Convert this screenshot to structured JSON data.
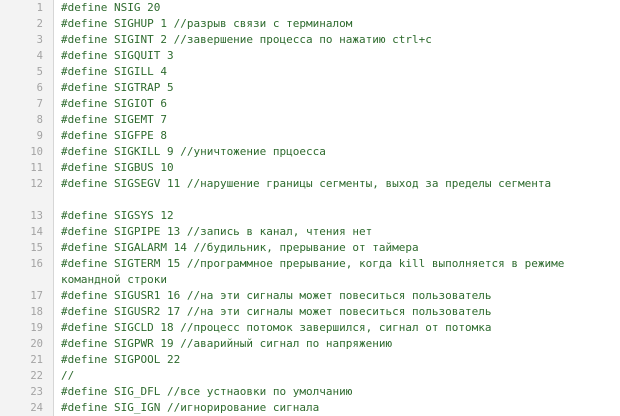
{
  "lines": [
    {
      "n": "1",
      "text": "#define NSIG 20"
    },
    {
      "n": "2",
      "text": "#define SIGHUP 1 //разрыв связи с терминалом"
    },
    {
      "n": "3",
      "text": "#define SIGINT 2 //завершение процесса по нажатию ctrl+c"
    },
    {
      "n": "4",
      "text": "#define SIGQUIT 3"
    },
    {
      "n": "5",
      "text": "#define SIGILL 4"
    },
    {
      "n": "6",
      "text": "#define SIGTRAP 5"
    },
    {
      "n": "7",
      "text": "#define SIGIOT 6"
    },
    {
      "n": "8",
      "text": "#define SIGEMT 7"
    },
    {
      "n": "9",
      "text": "#define SIGFPE 8"
    },
    {
      "n": "10",
      "text": "#define SIGKILL 9 //уничтожение прцоесса"
    },
    {
      "n": "11",
      "text": "#define SIGBUS 10"
    },
    {
      "n": "12",
      "text": "#define SIGSEGV 11 //нарушение границы сегменты, выход за пределы сегмента"
    },
    {
      "n": "13",
      "text": "#define SIGSYS 12"
    },
    {
      "n": "14",
      "text": "#define SIGPIPE 13 //запись в канал, чтения нет"
    },
    {
      "n": "15",
      "text": "#define SIGALARM 14 //будильник, прерывание от таймера"
    },
    {
      "n": "16",
      "text": "#define SIGTERM 15 //программное прерывание, когда kill выполняется в режиме командной строки"
    },
    {
      "n": "17",
      "text": "#define SIGUSR1 16 //на эти сигналы может повеситься пользователь"
    },
    {
      "n": "18",
      "text": "#define SIGUSR2 17 //на эти сигналы может повеситься пользователь"
    },
    {
      "n": "19",
      "text": "#define SIGCLD 18 //процесс потомок завершился, сигнал от потомка"
    },
    {
      "n": "20",
      "text": "#define SIGPWR 19 //аварийный сигнал по напряжению"
    },
    {
      "n": "21",
      "text": "#define SIGPOOL 22"
    },
    {
      "n": "22",
      "text": "//"
    },
    {
      "n": "23",
      "text": "#define SIG_DFL //все устнаовки по умолчанию"
    },
    {
      "n": "24",
      "text": "#define SIG_IGN //игнорирование сигнала"
    }
  ]
}
